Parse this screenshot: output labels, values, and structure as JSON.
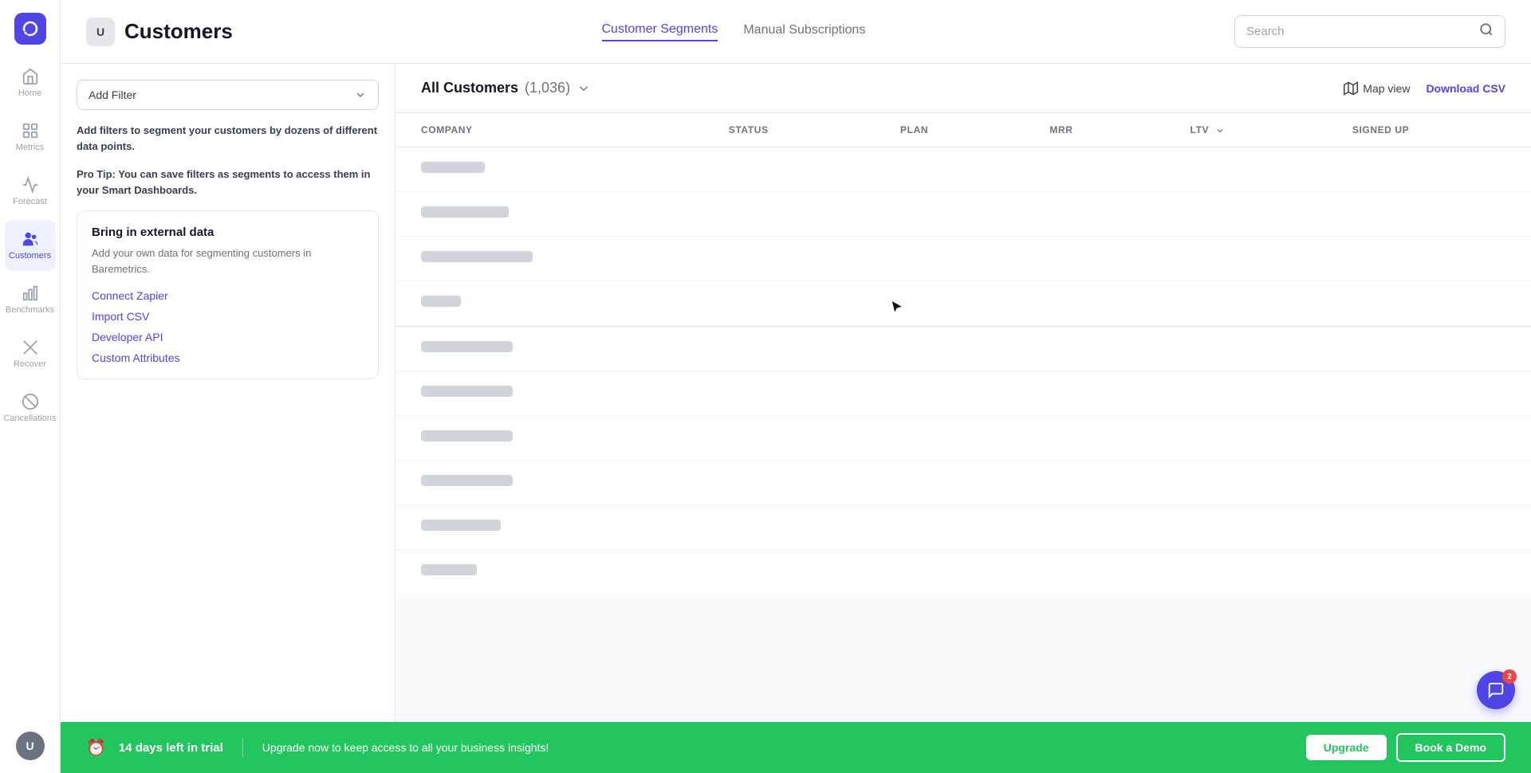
{
  "app": {
    "name": "Baremetrics"
  },
  "sidebar": {
    "items": [
      {
        "id": "home",
        "label": "Home",
        "active": false
      },
      {
        "id": "metrics",
        "label": "Metrics",
        "active": false
      },
      {
        "id": "forecast",
        "label": "Forecast",
        "active": false
      },
      {
        "id": "customers",
        "label": "Customers",
        "active": true
      },
      {
        "id": "benchmarks",
        "label": "Benchmarks",
        "active": false
      },
      {
        "id": "recover",
        "label": "Recover",
        "active": false
      },
      {
        "id": "cancellations",
        "label": "Cancellations",
        "active": false
      }
    ]
  },
  "header": {
    "badge": "U",
    "title": "Customers",
    "nav": [
      {
        "id": "customer-segments",
        "label": "Customer Segments",
        "active": true
      },
      {
        "id": "manual-subscriptions",
        "label": "Manual Subscriptions",
        "active": false
      }
    ],
    "search_placeholder": "Search"
  },
  "filter": {
    "label": "Add Filter"
  },
  "tip": {
    "main": "Add filters to segment your customers by dozens of different data points.",
    "pro": "Pro Tip: You can save filters as segments to access them in your Smart Dashboards."
  },
  "external_data": {
    "title": "Bring in external data",
    "description": "Add your own data for segmenting customers in Baremetrics.",
    "links": [
      {
        "id": "connect-zapier",
        "label": "Connect Zapier"
      },
      {
        "id": "import-csv",
        "label": "Import CSV"
      },
      {
        "id": "developer-api",
        "label": "Developer API"
      },
      {
        "id": "custom-attributes",
        "label": "Custom Attributes"
      }
    ]
  },
  "table": {
    "all_customers_label": "All Customers",
    "count": "(1,036)",
    "map_view_label": "Map view",
    "download_csv_label": "Download CSV",
    "columns": [
      {
        "id": "company",
        "label": "COMPANY"
      },
      {
        "id": "status",
        "label": "STATUS"
      },
      {
        "id": "plan",
        "label": "PLAN"
      },
      {
        "id": "mrr",
        "label": "MRR"
      },
      {
        "id": "ltv",
        "label": "LTV"
      },
      {
        "id": "signed_up",
        "label": "SIGNED UP"
      }
    ],
    "skeleton_rows": [
      {
        "widths": [
          "80",
          "0",
          "0",
          "0",
          "0",
          "0"
        ]
      },
      {
        "widths": [
          "110",
          "0",
          "0",
          "0",
          "0",
          "0"
        ]
      },
      {
        "widths": [
          "140",
          "0",
          "0",
          "0",
          "0",
          "0"
        ]
      },
      {
        "widths": [
          "50",
          "0",
          "0",
          "0",
          "0",
          "0"
        ]
      },
      {
        "widths": [
          "115",
          "0",
          "0",
          "0",
          "0",
          "0"
        ]
      },
      {
        "widths": [
          "115",
          "0",
          "0",
          "0",
          "0",
          "0"
        ]
      },
      {
        "widths": [
          "115",
          "0",
          "0",
          "0",
          "0",
          "0"
        ]
      },
      {
        "widths": [
          "115",
          "0",
          "0",
          "0",
          "0",
          "0"
        ]
      },
      {
        "widths": [
          "100",
          "0",
          "0",
          "0",
          "0",
          "0"
        ]
      },
      {
        "widths": [
          "70",
          "0",
          "0",
          "0",
          "0",
          "0"
        ]
      }
    ]
  },
  "trial_banner": {
    "days_left": "14 days left in trial",
    "message": "Upgrade now to keep access to all your business insights!",
    "upgrade_label": "Upgrade",
    "demo_label": "Book a Demo"
  },
  "chat": {
    "badge_count": "2"
  }
}
